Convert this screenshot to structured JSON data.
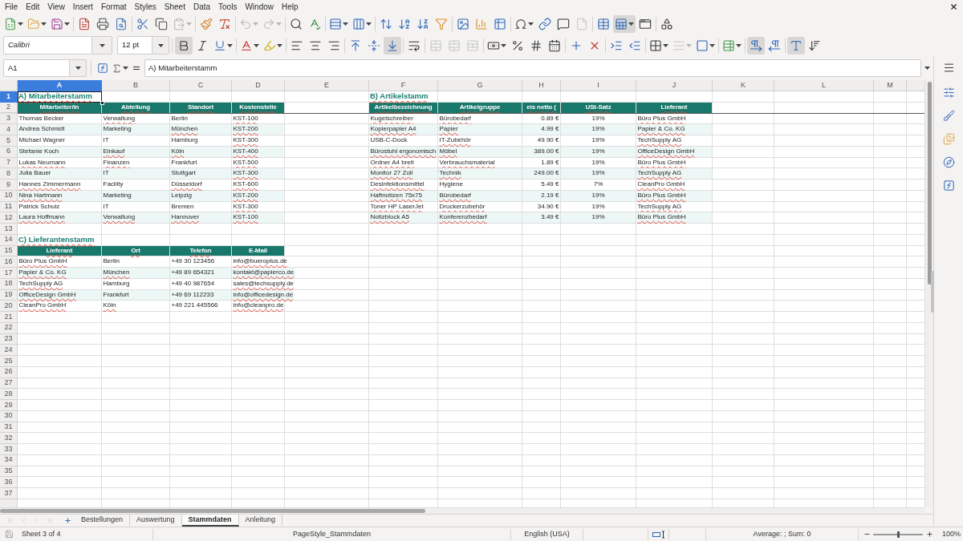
{
  "menu_bar": {
    "items": [
      "File",
      "Edit",
      "View",
      "Insert",
      "Format",
      "Styles",
      "Sheet",
      "Data",
      "Tools",
      "Window",
      "Help"
    ]
  },
  "standard_toolbar": [
    [
      {
        "kind": "new",
        "menu": true,
        "pressed": false,
        "disabled": false
      },
      {
        "kind": "open",
        "menu": true,
        "pressed": false,
        "disabled": false
      },
      {
        "kind": "save",
        "menu": true,
        "pressed": false,
        "disabled": false
      }
    ],
    [
      {
        "kind": "pdf",
        "menu": false,
        "pressed": false,
        "disabled": false
      },
      {
        "kind": "print",
        "menu": false,
        "pressed": false,
        "disabled": false
      },
      {
        "kind": "preview",
        "menu": false,
        "pressed": false,
        "disabled": false
      }
    ],
    [
      {
        "kind": "cut",
        "menu": false,
        "pressed": false,
        "disabled": false
      },
      {
        "kind": "copy",
        "menu": false,
        "pressed": false,
        "disabled": false
      },
      {
        "kind": "paste",
        "menu": true,
        "pressed": false,
        "disabled": true
      }
    ],
    [
      {
        "kind": "clone",
        "menu": false,
        "pressed": false,
        "disabled": false
      },
      {
        "kind": "clear",
        "menu": false,
        "pressed": false,
        "disabled": false
      }
    ],
    [
      {
        "kind": "undo",
        "menu": true,
        "pressed": false,
        "disabled": true
      },
      {
        "kind": "redo",
        "menu": true,
        "pressed": false,
        "disabled": true
      }
    ],
    [
      {
        "kind": "find",
        "menu": false,
        "pressed": false,
        "disabled": false
      },
      {
        "kind": "spelling",
        "menu": false,
        "pressed": false,
        "disabled": false
      }
    ],
    [
      {
        "kind": "rows",
        "menu": true,
        "pressed": false,
        "disabled": false
      },
      {
        "kind": "columns",
        "menu": true,
        "pressed": false,
        "disabled": false
      }
    ],
    [
      {
        "kind": "sort",
        "menu": false,
        "pressed": false,
        "disabled": false
      },
      {
        "kind": "sortup",
        "menu": false,
        "pressed": false,
        "disabled": false
      },
      {
        "kind": "sortdown",
        "menu": false,
        "pressed": false,
        "disabled": false
      },
      {
        "kind": "autofilter",
        "menu": false,
        "pressed": false,
        "disabled": false
      }
    ],
    [
      {
        "kind": "image",
        "menu": false,
        "pressed": false,
        "disabled": false
      },
      {
        "kind": "chart",
        "menu": false,
        "pressed": false,
        "disabled": false
      },
      {
        "kind": "pivot",
        "menu": false,
        "pressed": false,
        "disabled": false
      }
    ],
    [
      {
        "kind": "special",
        "menu": true,
        "pressed": false,
        "disabled": false
      },
      {
        "kind": "hyperlink",
        "menu": false,
        "pressed": false,
        "disabled": false
      },
      {
        "kind": "comment",
        "menu": false,
        "pressed": false,
        "disabled": false
      },
      {
        "kind": "headerfooter",
        "menu": false,
        "pressed": false,
        "disabled": true
      }
    ],
    [
      {
        "kind": "printarea",
        "menu": false,
        "pressed": false,
        "disabled": false
      },
      {
        "kind": "freeze",
        "menu": true,
        "pressed": true,
        "disabled": false
      },
      {
        "kind": "split",
        "menu": false,
        "pressed": false,
        "disabled": false
      }
    ],
    [
      {
        "kind": "draw",
        "menu": false,
        "pressed": false,
        "disabled": false
      }
    ]
  ],
  "formatting_toolbar": {
    "font_name": "Calibri",
    "font_size": "12 pt",
    "groups": [
      [
        {
          "kind": "bold",
          "menu": false,
          "pressed": true,
          "disabled": false
        },
        {
          "kind": "italic",
          "menu": false,
          "pressed": false,
          "disabled": false
        },
        {
          "kind": "underline",
          "menu": true,
          "pressed": false,
          "disabled": false
        }
      ],
      [
        {
          "kind": "fontcolor",
          "menu": true,
          "pressed": false,
          "disabled": false
        },
        {
          "kind": "highlight",
          "menu": true,
          "pressed": false,
          "disabled": false
        }
      ],
      [
        {
          "kind": "alignleft",
          "menu": false,
          "pressed": false,
          "disabled": false
        },
        {
          "kind": "aligncenter",
          "menu": false,
          "pressed": false,
          "disabled": false
        },
        {
          "kind": "alignright",
          "menu": false,
          "pressed": false,
          "disabled": false
        }
      ],
      [
        {
          "kind": "aligntop",
          "menu": false,
          "pressed": false,
          "disabled": false
        },
        {
          "kind": "alignmiddle",
          "menu": false,
          "pressed": false,
          "disabled": false
        },
        {
          "kind": "alignbottom",
          "menu": false,
          "pressed": true,
          "disabled": false
        }
      ],
      [
        {
          "kind": "wrap",
          "menu": false,
          "pressed": false,
          "disabled": false
        }
      ],
      [
        {
          "kind": "mergecenter",
          "menu": false,
          "pressed": false,
          "disabled": true
        },
        {
          "kind": "merge",
          "menu": false,
          "pressed": false,
          "disabled": true
        },
        {
          "kind": "unmerge",
          "menu": false,
          "pressed": false,
          "disabled": true
        }
      ],
      [
        {
          "kind": "currency",
          "menu": true,
          "pressed": false,
          "disabled": false
        },
        {
          "kind": "percent",
          "menu": false,
          "pressed": false,
          "disabled": false
        },
        {
          "kind": "number",
          "menu": false,
          "pressed": false,
          "disabled": false
        },
        {
          "kind": "date",
          "menu": false,
          "pressed": false,
          "disabled": false
        }
      ],
      [
        {
          "kind": "adddecimal",
          "menu": false,
          "pressed": false,
          "disabled": false
        },
        {
          "kind": "deletedecimal",
          "menu": false,
          "pressed": false,
          "disabled": false
        }
      ],
      [
        {
          "kind": "indent",
          "menu": false,
          "pressed": false,
          "disabled": false
        },
        {
          "kind": "outdent",
          "menu": false,
          "pressed": false,
          "disabled": false
        }
      ],
      [
        {
          "kind": "borders",
          "menu": true,
          "pressed": false,
          "disabled": false
        },
        {
          "kind": "borderstyle",
          "menu": true,
          "pressed": false,
          "disabled": true
        },
        {
          "kind": "bordercolor",
          "menu": true,
          "pressed": false,
          "disabled": false
        }
      ],
      [
        {
          "kind": "conditional",
          "menu": true,
          "pressed": false,
          "disabled": false
        }
      ],
      [
        {
          "kind": "ltr",
          "menu": false,
          "pressed": true,
          "disabled": false
        },
        {
          "kind": "rtl",
          "menu": false,
          "pressed": false,
          "disabled": false
        }
      ],
      [
        {
          "kind": "horizontal",
          "menu": false,
          "pressed": true,
          "disabled": false
        },
        {
          "kind": "vertical",
          "menu": false,
          "pressed": false,
          "disabled": false
        }
      ]
    ]
  },
  "formula_bar": {
    "cell_reference": "A1",
    "formula": "A) Mitarbeiterstamm"
  },
  "sheet": {
    "columns": [
      {
        "label": "A",
        "selected": true
      },
      {
        "label": "B",
        "selected": false
      },
      {
        "label": "C",
        "selected": false
      },
      {
        "label": "D",
        "selected": false
      },
      {
        "label": "E",
        "selected": false
      },
      {
        "label": "F",
        "selected": false
      },
      {
        "label": "G",
        "selected": false
      },
      {
        "label": "H",
        "selected": false
      },
      {
        "label": "I",
        "selected": false
      },
      {
        "label": "J",
        "selected": false
      },
      {
        "label": "K",
        "selected": false
      },
      {
        "label": "L",
        "selected": false
      },
      {
        "label": "M",
        "selected": false
      }
    ],
    "rows": [
      {
        "label": "1",
        "selected": true
      },
      {
        "label": "2",
        "selected": false
      },
      {
        "label": "3",
        "selected": false
      },
      {
        "label": "4",
        "selected": false
      },
      {
        "label": "5",
        "selected": false
      },
      {
        "label": "6",
        "selected": false
      },
      {
        "label": "7",
        "selected": false
      },
      {
        "label": "8",
        "selected": false
      },
      {
        "label": "9",
        "selected": false
      },
      {
        "label": "10",
        "selected": false
      },
      {
        "label": "11",
        "selected": false
      },
      {
        "label": "12",
        "selected": false
      },
      {
        "label": "13",
        "selected": false
      },
      {
        "label": "14",
        "selected": false
      },
      {
        "label": "15",
        "selected": false
      },
      {
        "label": "16",
        "selected": false
      },
      {
        "label": "17",
        "selected": false
      },
      {
        "label": "18",
        "selected": false
      },
      {
        "label": "19",
        "selected": false
      },
      {
        "label": "20",
        "selected": false
      },
      {
        "label": "21",
        "selected": false
      },
      {
        "label": "22",
        "selected": false
      },
      {
        "label": "23",
        "selected": false
      },
      {
        "label": "24",
        "selected": false
      },
      {
        "label": "25",
        "selected": false
      },
      {
        "label": "26",
        "selected": false
      },
      {
        "label": "27",
        "selected": false
      },
      {
        "label": "28",
        "selected": false
      },
      {
        "label": "29",
        "selected": false
      },
      {
        "label": "30",
        "selected": false
      },
      {
        "label": "31",
        "selected": false
      },
      {
        "label": "32",
        "selected": false
      },
      {
        "label": "33",
        "selected": false
      },
      {
        "label": "34",
        "selected": false
      },
      {
        "label": "35",
        "selected": false
      },
      {
        "label": "36",
        "selected": false
      },
      {
        "label": "37",
        "selected": false
      }
    ],
    "tables": [
      {
        "title": {
          "text": "A) Mitarbeiterstamm",
          "flagged": true
        },
        "columns": [
          {
            "text": "Mitarbeiter/in",
            "flagged": true
          },
          {
            "text": "Abteilung",
            "flagged": true
          },
          {
            "text": "Standort",
            "flagged": true
          },
          {
            "text": "Kostenstelle",
            "flagged": true
          }
        ],
        "rows": [
          [
            {
              "text": "Thomas Becker",
              "flagged": false
            },
            {
              "text": "Verwaltung",
              "flagged": true
            },
            {
              "text": "Berlin",
              "flagged": false
            },
            {
              "text": "KST-100",
              "flagged": true
            }
          ],
          [
            {
              "text": "Andrea Schmidt",
              "flagged": false
            },
            {
              "text": "Marketing",
              "flagged": false
            },
            {
              "text": "München",
              "flagged": true
            },
            {
              "text": "KST-200",
              "flagged": true
            }
          ],
          [
            {
              "text": "Michael Wagner",
              "flagged": false
            },
            {
              "text": "IT",
              "flagged": false
            },
            {
              "text": "Hamburg",
              "flagged": false
            },
            {
              "text": "KST-300",
              "flagged": true
            }
          ],
          [
            {
              "text": "Stefanie Koch",
              "flagged": false
            },
            {
              "text": "Einkauf",
              "flagged": true
            },
            {
              "text": "Köln",
              "flagged": true
            },
            {
              "text": "KST-400",
              "flagged": true
            }
          ],
          [
            {
              "text": "Lukas Neumann",
              "flagged": true
            },
            {
              "text": "Finanzen",
              "flagged": true
            },
            {
              "text": "Frankfurt",
              "flagged": false
            },
            {
              "text": "KST-500",
              "flagged": true
            }
          ],
          [
            {
              "text": "Julia Bauer",
              "flagged": false
            },
            {
              "text": "IT",
              "flagged": false
            },
            {
              "text": "Stuttgart",
              "flagged": false
            },
            {
              "text": "KST-300",
              "flagged": true
            }
          ],
          [
            {
              "text": "Hannes Zimmermann",
              "flagged": true
            },
            {
              "text": "Facility",
              "flagged": false
            },
            {
              "text": "Düsseldorf",
              "flagged": true
            },
            {
              "text": "KST-600",
              "flagged": true
            }
          ],
          [
            {
              "text": "Nina Hartmann",
              "flagged": true
            },
            {
              "text": "Marketing",
              "flagged": false
            },
            {
              "text": "Leipzig",
              "flagged": false
            },
            {
              "text": "KST-200",
              "flagged": true
            }
          ],
          [
            {
              "text": "Patrick Schulz",
              "flagged": false
            },
            {
              "text": "IT",
              "flagged": false
            },
            {
              "text": "Bremen",
              "flagged": false
            },
            {
              "text": "KST-300",
              "flagged": true
            }
          ],
          [
            {
              "text": "Laura Hoffmann",
              "flagged": true
            },
            {
              "text": "Verwaltung",
              "flagged": true
            },
            {
              "text": "Hannover",
              "flagged": true
            },
            {
              "text": "KST-100",
              "flagged": true
            }
          ]
        ]
      },
      {
        "title": {
          "text": "B) Artikelstamm",
          "flagged": true
        },
        "columns": [
          {
            "text": "Artikelbezeichnung",
            "flagged": true
          },
          {
            "text": "Artikelgruppe",
            "flagged": true
          },
          {
            "text": "eis netto (",
            "flagged": true
          },
          {
            "text": "USt-Satz",
            "flagged": true
          },
          {
            "text": "Lieferant",
            "flagged": true
          }
        ],
        "rows": [
          [
            {
              "text": "Kugelschreiber",
              "flagged": true
            },
            {
              "text": "Bürobedarf",
              "flagged": true
            },
            {
              "text": "0.89 €",
              "flagged": false
            },
            {
              "text": "19%",
              "flagged": false
            },
            {
              "text": "Büro Plus GmbH",
              "flagged": true
            }
          ],
          [
            {
              "text": "Kopierpapier A4",
              "flagged": true
            },
            {
              "text": "Papier",
              "flagged": true
            },
            {
              "text": "4.99 €",
              "flagged": false
            },
            {
              "text": "19%",
              "flagged": false
            },
            {
              "text": "Papier & Co. KG",
              "flagged": true
            }
          ],
          [
            {
              "text": "USB-C-Dock",
              "flagged": false
            },
            {
              "text": "IT-Zubehör",
              "flagged": true
            },
            {
              "text": "49.90 €",
              "flagged": false
            },
            {
              "text": "19%",
              "flagged": false
            },
            {
              "text": "TechSupply AG",
              "flagged": true
            }
          ],
          [
            {
              "text": "Bürostuhl ergonomisch",
              "flagged": true
            },
            {
              "text": "Möbel",
              "flagged": true
            },
            {
              "text": "389.00 €",
              "flagged": false
            },
            {
              "text": "19%",
              "flagged": false
            },
            {
              "text": "OfficeDesign GmbH",
              "flagged": true
            }
          ],
          [
            {
              "text": "Ordner A4 breit",
              "flagged": true
            },
            {
              "text": "Verbrauchsmaterial",
              "flagged": true
            },
            {
              "text": "1.89 €",
              "flagged": false
            },
            {
              "text": "19%",
              "flagged": false
            },
            {
              "text": "Büro Plus GmbH",
              "flagged": true
            }
          ],
          [
            {
              "text": "Monitor 27 Zoll",
              "flagged": true
            },
            {
              "text": "Technik",
              "flagged": true
            },
            {
              "text": "249.00 €",
              "flagged": false
            },
            {
              "text": "19%",
              "flagged": false
            },
            {
              "text": "TechSupply AG",
              "flagged": true
            }
          ],
          [
            {
              "text": "Desinfektionsmittel",
              "flagged": true
            },
            {
              "text": "Hygiene",
              "flagged": false
            },
            {
              "text": "5.49 €",
              "flagged": false
            },
            {
              "text": "7%",
              "flagged": false
            },
            {
              "text": "CleanPro GmbH",
              "flagged": true
            }
          ],
          [
            {
              "text": "Haftnotizen 75x75",
              "flagged": true
            },
            {
              "text": "Bürobedarf",
              "flagged": true
            },
            {
              "text": "2.19 €",
              "flagged": false
            },
            {
              "text": "19%",
              "flagged": false
            },
            {
              "text": "Büro Plus GmbH",
              "flagged": true
            }
          ],
          [
            {
              "text": "Toner HP LaserJet",
              "flagged": true
            },
            {
              "text": "Druckerzubehör",
              "flagged": true
            },
            {
              "text": "34.90 €",
              "flagged": false
            },
            {
              "text": "19%",
              "flagged": false
            },
            {
              "text": "TechSupply AG",
              "flagged": true
            }
          ],
          [
            {
              "text": "Notizblock A5",
              "flagged": true
            },
            {
              "text": "Konferenzbedarf",
              "flagged": true
            },
            {
              "text": "3.49 €",
              "flagged": false
            },
            {
              "text": "19%",
              "flagged": false
            },
            {
              "text": "Büro Plus GmbH",
              "flagged": true
            }
          ]
        ]
      },
      {
        "title": {
          "text": "C) Lieferantenstamm",
          "flagged": true
        },
        "columns": [
          {
            "text": "Lieferant",
            "flagged": true
          },
          {
            "text": "Ort",
            "flagged": true
          },
          {
            "text": "Telefon",
            "flagged": true
          },
          {
            "text": "E-Mail",
            "flagged": false
          }
        ],
        "rows": [
          [
            {
              "text": "Büro Plus GmbH",
              "flagged": true
            },
            {
              "text": "Berlin",
              "flagged": false
            },
            {
              "text": "+49 30 123456",
              "flagged": false
            },
            {
              "text": "info@bueroplus.de",
              "flagged": true
            }
          ],
          [
            {
              "text": "Papier & Co. KG",
              "flagged": true
            },
            {
              "text": "München",
              "flagged": true
            },
            {
              "text": "+49 89 654321",
              "flagged": false
            },
            {
              "text": "kontakt@papierco.de",
              "flagged": true
            }
          ],
          [
            {
              "text": "TechSupply AG",
              "flagged": true
            },
            {
              "text": "Hamburg",
              "flagged": false
            },
            {
              "text": "+49 40 987654",
              "flagged": false
            },
            {
              "text": "sales@techsupply.de",
              "flagged": true
            }
          ],
          [
            {
              "text": "OfficeDesign GmbH",
              "flagged": true
            },
            {
              "text": "Frankfurt",
              "flagged": false
            },
            {
              "text": "+49 69 112233",
              "flagged": false
            },
            {
              "text": "info@officedesign.de",
              "flagged": true
            }
          ],
          [
            {
              "text": "CleanPro GmbH",
              "flagged": true
            },
            {
              "text": "Köln",
              "flagged": true
            },
            {
              "text": "+49 221 445566",
              "flagged": false
            },
            {
              "text": "info@cleanpro.de",
              "flagged": true
            }
          ]
        ]
      }
    ]
  },
  "sheet_navigation": [
    {
      "kind": "first",
      "disabled": true
    },
    {
      "kind": "previous",
      "disabled": true
    },
    {
      "kind": "next",
      "disabled": true
    },
    {
      "kind": "last",
      "disabled": true
    }
  ],
  "sheet_tabs": [
    {
      "label": "Bestellungen",
      "selected": false
    },
    {
      "label": "Auswertung",
      "selected": false
    },
    {
      "label": "Stammdaten",
      "selected": true
    },
    {
      "label": "Anleitung",
      "selected": false
    }
  ],
  "sidebar": [
    {
      "kind": "menu"
    },
    {
      "kind": "properties"
    },
    {
      "kind": "styles"
    },
    {
      "kind": "gallery"
    },
    {
      "kind": "navigator"
    },
    {
      "kind": "functions"
    }
  ],
  "status_bar": {
    "sheet": "Sheet 3 of 4",
    "page_style": "PageStyle_Stammdaten",
    "language": "English (USA)",
    "selection_summary": "Average: ; Sum: 0",
    "zoom": {
      "level": 0.5,
      "reading": "100%"
    }
  }
}
